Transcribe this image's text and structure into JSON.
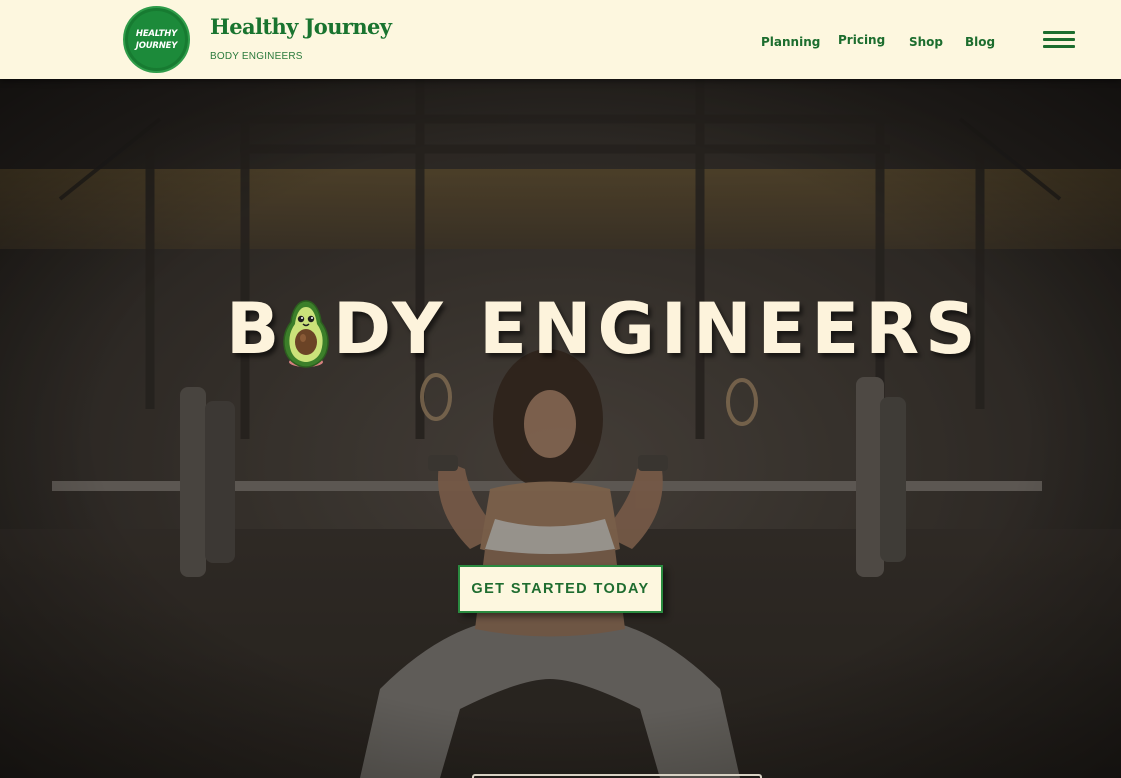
{
  "header": {
    "logo_badge": {
      "line1": "HEALTHY",
      "line2": "JOURNEY"
    },
    "brand_name": "Healthy Journey",
    "brand_sub": "BODY ENGINEERS",
    "nav": {
      "planning": "Planning",
      "pricing": "Pricing",
      "shop": "Shop",
      "blog": "Blog"
    },
    "menu_icon": "hamburger-menu-icon"
  },
  "hero": {
    "title_first_letter": "B",
    "title_rest": "DY ENGINEERS",
    "title_o_icon": "avocado-icon",
    "cta_label": "GET STARTED TODAY",
    "background": "woman-lifting-barbell-photo"
  },
  "colors": {
    "header_bg": "#fdf7df",
    "brand_green": "#19742f",
    "badge_green": "#1c8a3a",
    "title_cream": "#fdf3dc"
  }
}
